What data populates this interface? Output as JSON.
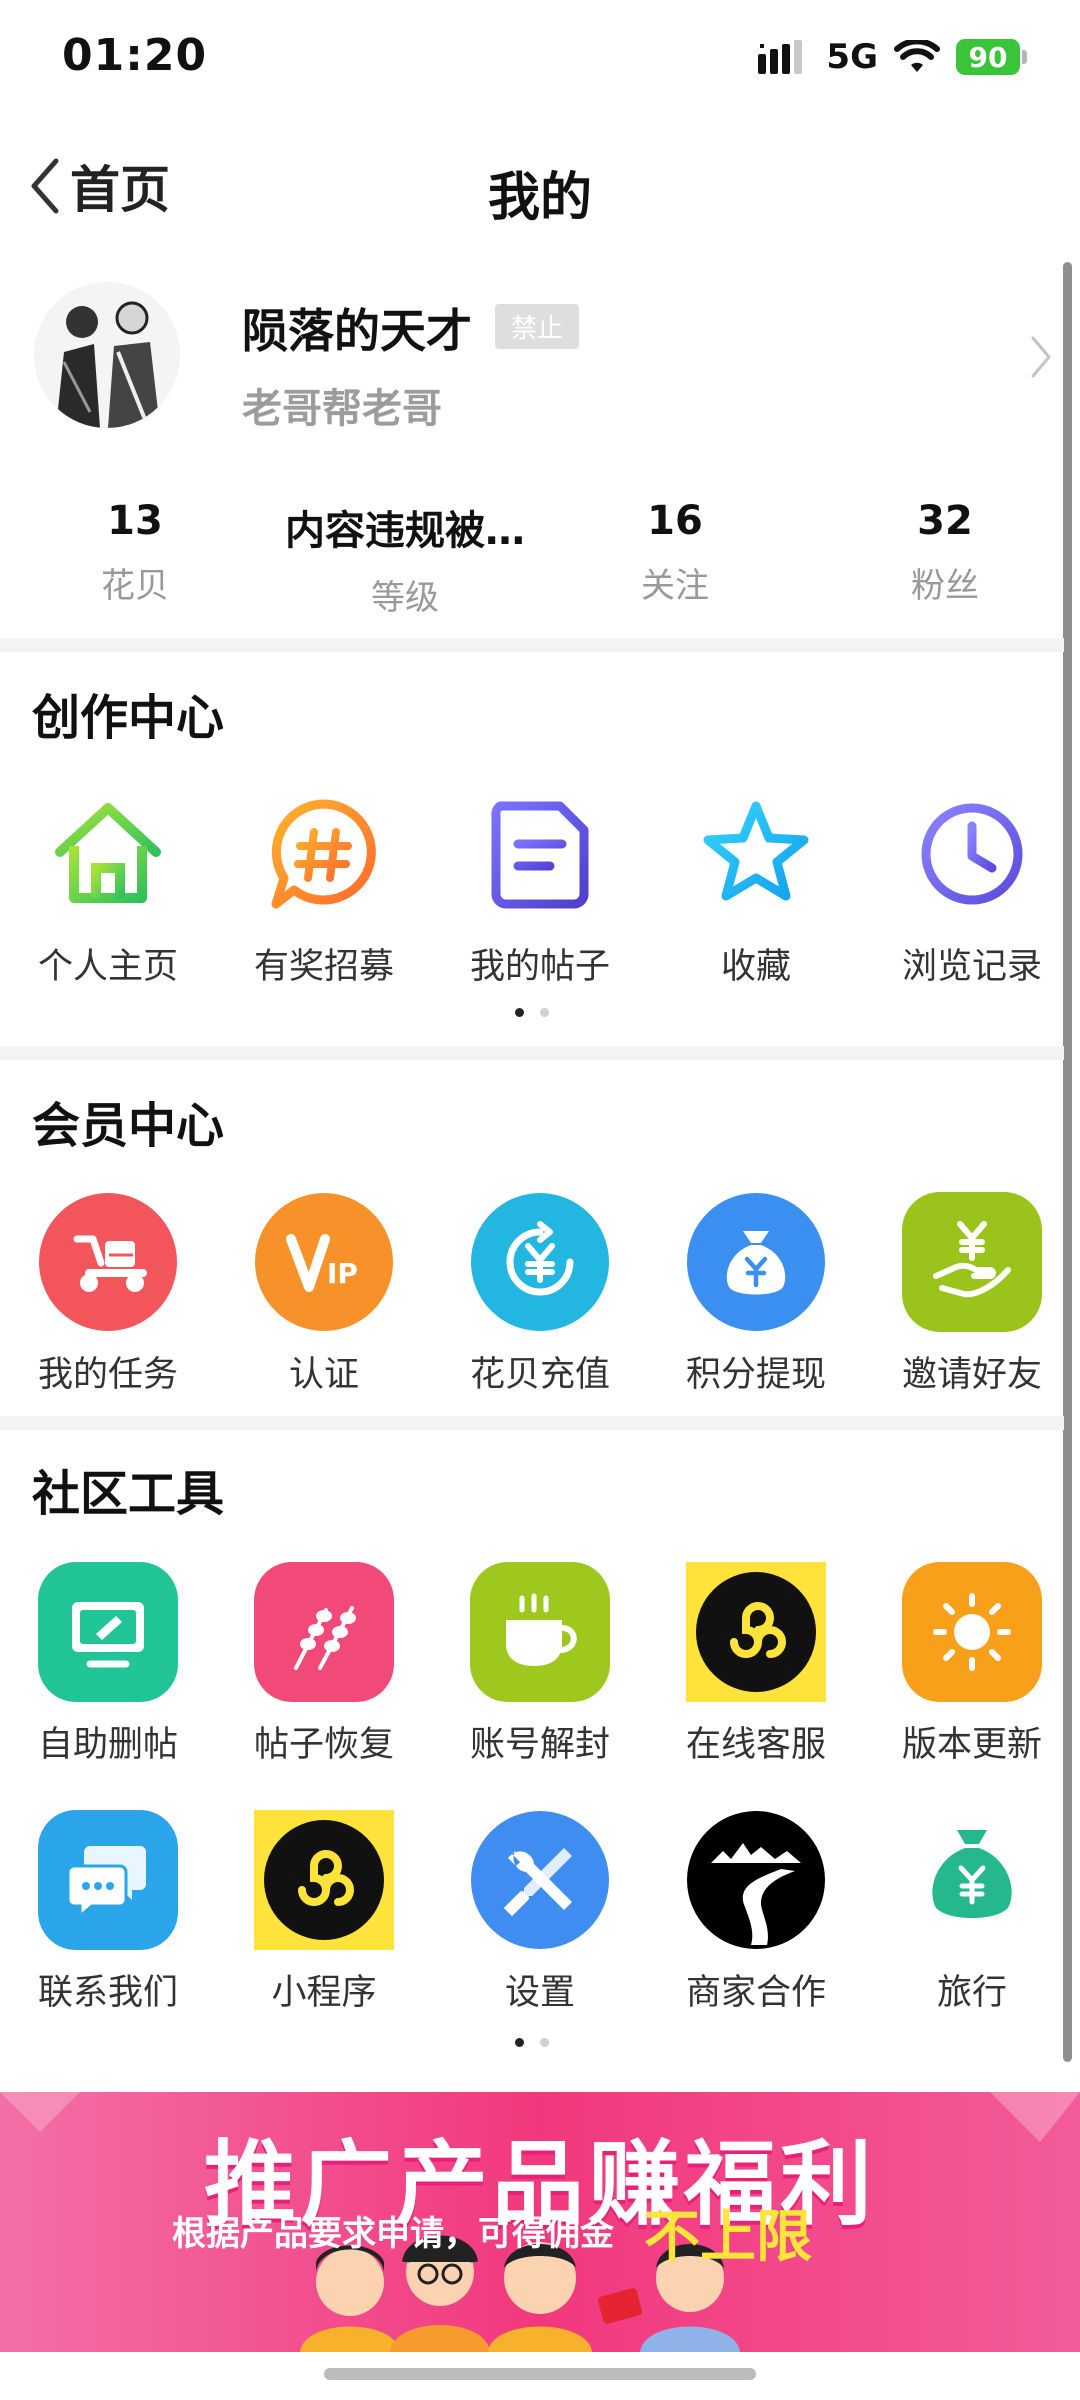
{
  "status_bar": {
    "time": "01:20",
    "network": "5G",
    "battery": "90"
  },
  "nav": {
    "back_label": "首页",
    "title": "我的"
  },
  "profile": {
    "username": "陨落的天才",
    "badge": "禁止",
    "signature": "老哥帮老哥"
  },
  "stats": [
    {
      "value": "13",
      "label": "花贝"
    },
    {
      "value": "内容违规被…",
      "label": "等级"
    },
    {
      "value": "16",
      "label": "关注"
    },
    {
      "value": "32",
      "label": "粉丝"
    }
  ],
  "creation_center": {
    "title": "创作中心",
    "items": [
      {
        "label": "个人主页",
        "icon": "home-icon"
      },
      {
        "label": "有奖招募",
        "icon": "hashtag-icon"
      },
      {
        "label": "我的帖子",
        "icon": "post-icon"
      },
      {
        "label": "收藏",
        "icon": "star-icon"
      },
      {
        "label": "浏览记录",
        "icon": "clock-icon"
      }
    ]
  },
  "member_center": {
    "title": "会员中心",
    "items": [
      {
        "label": "我的任务",
        "icon": "scooter-icon",
        "color": "#f2555a"
      },
      {
        "label": "认证",
        "icon": "vip-icon",
        "color": "#f7922a"
      },
      {
        "label": "花贝充值",
        "icon": "yuan-recharge-icon",
        "color": "#23b6e0"
      },
      {
        "label": "积分提现",
        "icon": "money-bag-icon",
        "color": "#3a8ff0"
      },
      {
        "label": "邀请好友",
        "icon": "hand-yuan-icon",
        "color": "#9ac31c"
      }
    ]
  },
  "community_tools": {
    "title": "社区工具",
    "items": [
      {
        "label": "自助删帖",
        "icon": "monitor-pen-icon",
        "color": "#21c497"
      },
      {
        "label": "帖子恢复",
        "icon": "skewer-icon",
        "color": "#f24a78"
      },
      {
        "label": "账号解封",
        "icon": "coffee-cup-icon",
        "color": "#9ec81d"
      },
      {
        "label": "在线客服",
        "icon": "mini-program-icon",
        "color": "#ffe23a"
      },
      {
        "label": "版本更新",
        "icon": "sun-icon",
        "color": "#f9a01b"
      },
      {
        "label": "联系我们",
        "icon": "chat-bubbles-icon",
        "color": "#2aa5ea"
      },
      {
        "label": "小程序",
        "icon": "mini-program-icon",
        "color": "#ffe23a"
      },
      {
        "label": "设置",
        "icon": "wrench-screwdriver-icon",
        "color": "#3f8df0"
      },
      {
        "label": "商家合作",
        "icon": "mountain-road-icon",
        "color": "#000000"
      },
      {
        "label": "旅行",
        "icon": "money-bag-icon",
        "color": "#25b88f"
      }
    ]
  },
  "banner": {
    "title": "推广产品赚福利",
    "subtitle": "根据产品要求申请，可得佣金",
    "highlight": "不上限"
  }
}
